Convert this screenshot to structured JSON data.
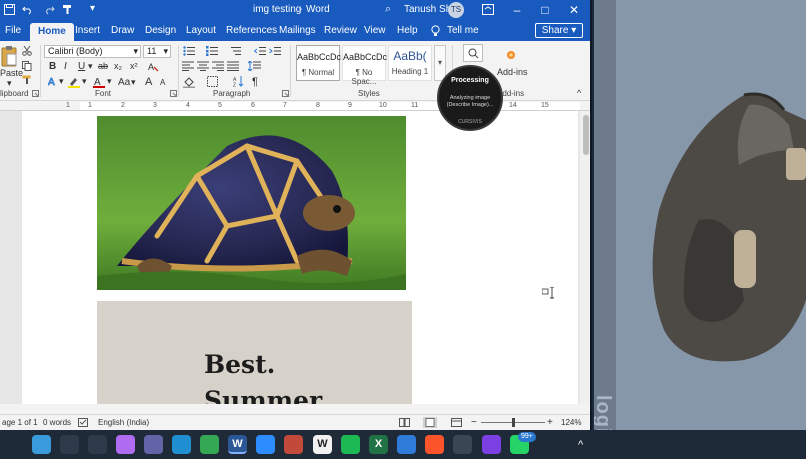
{
  "quick_access": {
    "more": "▾"
  },
  "title": {
    "doc": "img testing",
    "app": "Word",
    "sep": "-",
    "search_hint": "⌕",
    "user": "Tanush Shah",
    "initials": "TS"
  },
  "tabs": [
    "File",
    "Home",
    "Insert",
    "Draw",
    "Design",
    "Layout",
    "References",
    "Mailings",
    "Review",
    "View",
    "Help"
  ],
  "tell_me": "Tell me",
  "share_label": "Share",
  "ribbon": {
    "clipboard": {
      "paste": "Paste",
      "label": "lipboard"
    },
    "font": {
      "name": "Calibri (Body)",
      "size": "11",
      "label": "Font",
      "buttons": [
        "B",
        "I",
        "U",
        "ab",
        "x₂",
        "x²"
      ],
      "case": "Aa",
      "grow": "A",
      "shrink": "A"
    },
    "paragraph": {
      "label": "Paragraph"
    },
    "styles": {
      "label": "Styles",
      "items": [
        {
          "preview": "AaBbCcDc",
          "name": "¶ Normal"
        },
        {
          "preview": "AaBbCcDc",
          "name": "¶ No Spac..."
        },
        {
          "preview": "AaBb(",
          "name": "Heading 1"
        }
      ]
    },
    "addins": {
      "name": "Add-ins",
      "label": "Add-ins"
    }
  },
  "ruler": {
    "numbers": [
      "1",
      "1",
      "2",
      "3",
      "4",
      "5",
      "6",
      "7",
      "8",
      "9",
      "10",
      "11",
      "12",
      "13",
      "14",
      "15"
    ]
  },
  "document": {
    "text_lines": [
      "Best.",
      "Summer"
    ]
  },
  "overlay": {
    "title": "Processing",
    "body": "Analyzing image (Describe Image)...",
    "brand": "CURSIVIS"
  },
  "statusbar": {
    "page": "age 1 of 1",
    "words": "0 words",
    "language": "English (India)",
    "zoom_minus": "−",
    "zoom_plus": "+",
    "zoom": "124%"
  },
  "side": {
    "brand_text": "logi"
  },
  "taskbar": {
    "apps": [
      {
        "name": "windows-start",
        "color": "#3a9bdc"
      },
      {
        "name": "search",
        "color": "#2c3a4a"
      },
      {
        "name": "task-view",
        "color": "#2c3a4a"
      },
      {
        "name": "copilot",
        "color": "#b06cf0"
      },
      {
        "name": "teams",
        "color": "#6264a7"
      },
      {
        "name": "edge",
        "color": "#1f8fd1"
      },
      {
        "name": "chrome",
        "color": "#34a853"
      },
      {
        "name": "word",
        "color": "#2b5797",
        "glyph": "W"
      },
      {
        "name": "zoom",
        "color": "#2d8cff"
      },
      {
        "name": "media",
        "color": "#c24a3a"
      },
      {
        "name": "wikipedia",
        "color": "#f1f1f1",
        "glyph": "W"
      },
      {
        "name": "spotify",
        "color": "#1db954"
      },
      {
        "name": "excel",
        "color": "#217346",
        "glyph": "X"
      },
      {
        "name": "bluetooth",
        "color": "#2f7bd9"
      },
      {
        "name": "brave",
        "color": "#fb542b"
      },
      {
        "name": "clock-app",
        "color": "#3b4654"
      },
      {
        "name": "clipchamp",
        "color": "#7b3fe4"
      },
      {
        "name": "whatsapp",
        "color": "#25d366"
      }
    ],
    "badge": "99+",
    "chevron": "^"
  }
}
